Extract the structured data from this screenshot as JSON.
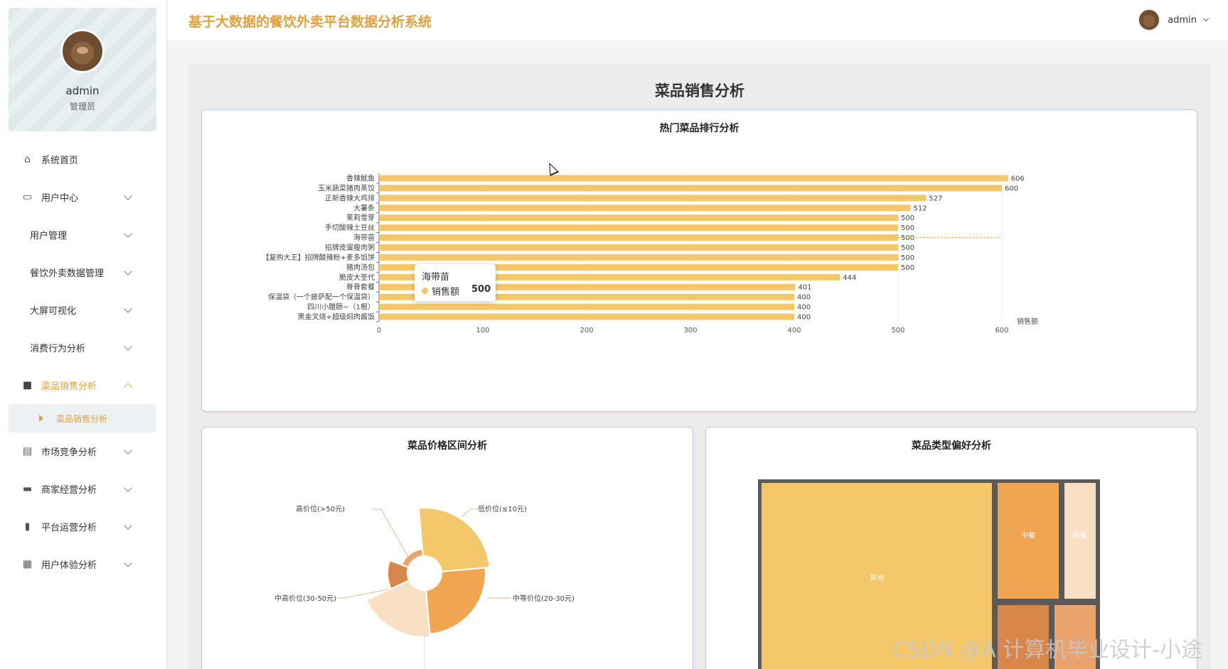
{
  "header": {
    "title": "基于大数据的餐饮外卖平台数据分析系统",
    "user_name": "admin"
  },
  "profile": {
    "name": "admin",
    "role": "管理员"
  },
  "sidebar": {
    "items": [
      {
        "label": "系统首页",
        "icon": "home-icon"
      },
      {
        "label": "用户中心",
        "icon": "card-icon"
      },
      {
        "label": "用户管理"
      },
      {
        "label": "餐饮外卖数据管理"
      },
      {
        "label": "大屏可视化"
      },
      {
        "label": "消费行为分析"
      },
      {
        "label": "菜品销售分析",
        "icon": "bag-icon",
        "active": true
      },
      {
        "label": "市场竞争分析",
        "icon": "clipboard-icon"
      },
      {
        "label": "商家经营分析",
        "icon": "monitor-icon"
      },
      {
        "label": "平台运营分析",
        "icon": "bar-chart-icon"
      },
      {
        "label": "用户体验分析",
        "icon": "grid-icon"
      }
    ],
    "active_sub": "菜品销售分析"
  },
  "main": {
    "page_title": "菜品销售分析"
  },
  "cards": {
    "ranking": {
      "title": "热门菜品排行分析"
    },
    "price": {
      "title": "菜品价格区间分析"
    },
    "type": {
      "title": "菜品类型偏好分析"
    }
  },
  "tooltip": {
    "title": "海带苗",
    "series": "销售额",
    "value": "500"
  },
  "chart_data": [
    {
      "type": "bar",
      "orientation": "horizontal",
      "title": "热门菜品排行分析",
      "categories": [
        "香辣鱿鱼",
        "玉米蔬菜猪肉蒸饺",
        "正新香辣大鸡排",
        "大薯条",
        "茉莉雪芽",
        "手切酸辣土豆丝",
        "海带苗",
        "招牌皮蛋瘦肉粥",
        "【复购大王】招牌酸辣粉+麦多馅饼",
        "猪肉汤包",
        "脆皮大圣代",
        "脊骨套餐",
        "保温袋（一个披萨配一个保温袋）",
        "四川小腊肠~（1根）",
        "黑金叉烧+超级焖肉酱饭"
      ],
      "series": [
        {
          "name": "销售额",
          "values": [
            606,
            600,
            527,
            512,
            500,
            500,
            500,
            500,
            500,
            500,
            444,
            401,
            400,
            400,
            400
          ]
        }
      ],
      "xlabel": "销售额",
      "xlim": [
        0,
        600
      ],
      "xticks": [
        0,
        100,
        200,
        300,
        400,
        500,
        600
      ],
      "color": "#f5c76b",
      "grid": true
    },
    {
      "type": "pie",
      "variant": "rose",
      "title": "菜品价格区间分析",
      "labels": [
        "低价位(≤10元)",
        "中等价位(20-30元)",
        "中高价位(30-50元)",
        "高价位(>50元)"
      ],
      "values": [
        100,
        90,
        42,
        18
      ],
      "colors": [
        "#f5c76b",
        "#f0a552",
        "#d8864a",
        "#eba36e"
      ],
      "note": "bottom slice partially cut off by viewport; its label not visible"
    },
    {
      "type": "treemap",
      "title": "菜品类型偏好分析",
      "labels": [
        "其他",
        "中餐",
        "快餐"
      ],
      "colors": [
        "#f5c76b",
        "#f0a552",
        "#f9dfc4"
      ]
    }
  ]
}
